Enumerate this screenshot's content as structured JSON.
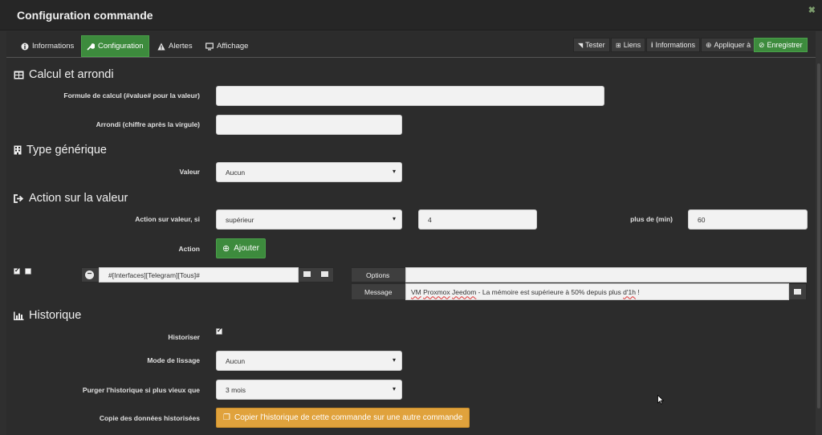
{
  "window": {
    "title": "Configuration commande"
  },
  "tabs": [
    {
      "label": "Informations",
      "icon": "info-circle-icon"
    },
    {
      "label": "Configuration",
      "icon": "wrench-icon"
    },
    {
      "label": "Alertes",
      "icon": "warning-triangle-icon"
    },
    {
      "label": "Affichage",
      "icon": "monitor-icon"
    }
  ],
  "toolbar": {
    "tester": "Tester",
    "liens": "Liens",
    "informations": "Informations",
    "appliquer": "Appliquer à",
    "enregistrer": "Enregistrer"
  },
  "calcul": {
    "title": "Calcul et arrondi",
    "formule_label": "Formule de calcul (#value# pour la valeur)",
    "formule_value": "",
    "arrondi_label": "Arrondi (chiffre après la virgule)",
    "arrondi_value": ""
  },
  "generic": {
    "title": "Type générique",
    "valeur_label": "Valeur",
    "valeur_selected": "Aucun"
  },
  "action": {
    "title": "Action sur la valeur",
    "condition_label": "Action sur valeur, si",
    "operator_selected": "supérieur",
    "threshold_value": "4",
    "duration_label": "plus de (min)",
    "duration_value": "60",
    "action_label": "Action",
    "add_button": "Ajouter",
    "cmd_value": "#[Interfaces][Telegram][Tous]#",
    "options_label": "Options",
    "options_value": "",
    "message_label": "Message",
    "message_parts": [
      "VM",
      " ",
      "Proxmox",
      " ",
      "Jeedom",
      " - La mémoire est supérieure à 50% depuis plus ",
      "d'1h",
      " !"
    ],
    "check1": true,
    "check2": false
  },
  "history": {
    "title": "Historique",
    "historiser_label": "Historiser",
    "historiser_checked": true,
    "lissage_label": "Mode de lissage",
    "lissage_selected": "Aucun",
    "purge_label": "Purger l'historique si plus vieux que",
    "purge_selected": "3 mois",
    "copy_label": "Copie des données historisées",
    "copy_button": "Copier l'historique de cette commande sur une autre commande"
  },
  "colors": {
    "accent_green": "#3d8b3d",
    "orange": "#e0a23c",
    "background": "#2c2c2c"
  }
}
